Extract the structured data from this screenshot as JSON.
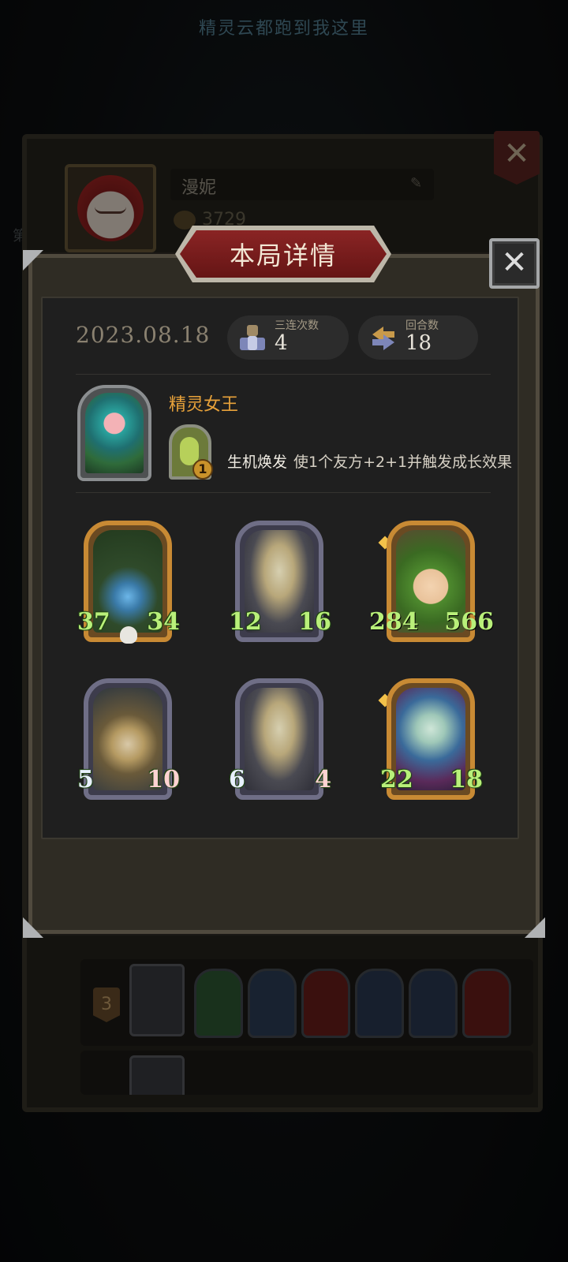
{
  "background": {
    "banner_text": "精灵云都跑到我这里",
    "side_text": "第"
  },
  "profile": {
    "name": "漫妮",
    "coins": "3729",
    "history": [
      {
        "rank": "3"
      },
      {
        "rank": ""
      }
    ]
  },
  "dialog": {
    "title": "本局详情",
    "date": "2023.08.18",
    "stats": {
      "triples_label": "三连次数",
      "triples_value": "4",
      "rounds_label": "回合数",
      "rounds_value": "18"
    },
    "hero": {
      "name": "精灵女王",
      "skill_level": "1",
      "skill_name": "生机焕发",
      "skill_text": "使1个友方+2+1并触发成长效果"
    },
    "units": [
      {
        "attack": "37",
        "health": "34",
        "frame": "gold",
        "art": "heart",
        "dead": true
      },
      {
        "attack": "12",
        "health": "16",
        "frame": "silver",
        "art": "mushroom"
      },
      {
        "attack": "284",
        "health": "566",
        "frame": "gold",
        "art": "sprout"
      },
      {
        "attack": "5",
        "health": "10",
        "frame": "silver",
        "art": "wizard"
      },
      {
        "attack": "6",
        "health": "4",
        "frame": "silver",
        "art": "mushroom"
      },
      {
        "attack": "22",
        "health": "18",
        "frame": "gold",
        "art": "elf"
      }
    ]
  },
  "colors": {
    "accent_gold": "#e8a23a",
    "title_red": "#7e1e1e",
    "stat_green": "#b9f07a"
  },
  "icons": {
    "close": "close-icon",
    "triples": "stack-icon",
    "rounds": "cycle-arrows-icon",
    "edit": "pencil-icon"
  }
}
